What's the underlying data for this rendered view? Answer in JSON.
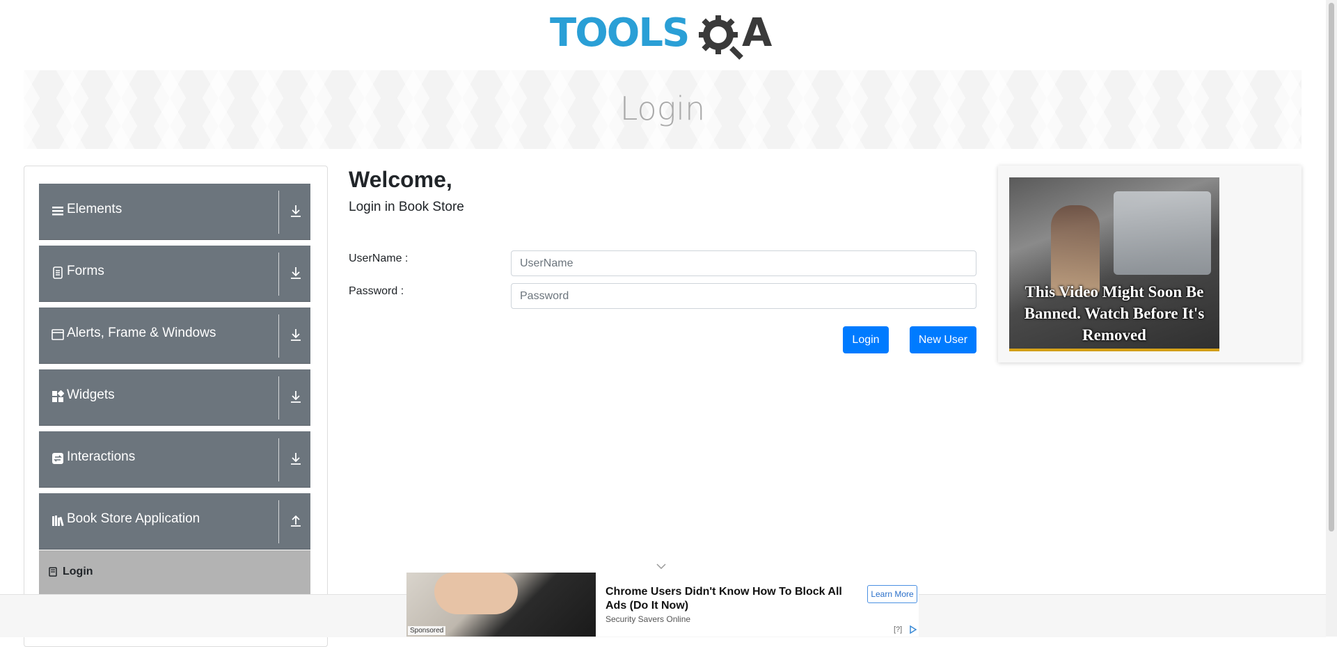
{
  "logo": {
    "text_tools": "TOOLS",
    "text_a": "A",
    "brand_color": "#2a9fd6"
  },
  "banner": {
    "title": "Login"
  },
  "sidebar": {
    "groups": [
      {
        "label": "Elements",
        "icon": "hamburger-icon",
        "state": "collapsed"
      },
      {
        "label": "Forms",
        "icon": "document-icon",
        "state": "collapsed"
      },
      {
        "label": "Alerts, Frame & Windows",
        "icon": "window-icon",
        "state": "collapsed"
      },
      {
        "label": "Widgets",
        "icon": "widgets-icon",
        "state": "collapsed"
      },
      {
        "label": "Interactions",
        "icon": "interactions-icon",
        "state": "collapsed"
      },
      {
        "label": "Book Store Application",
        "icon": "books-icon",
        "state": "expanded"
      }
    ],
    "submenu": {
      "label": "Login",
      "icon": "book-icon"
    },
    "header_color": "#6c757d",
    "active_item_color": "#b3b3b3"
  },
  "main": {
    "welcome": "Welcome,",
    "subtitle": "Login in Book Store",
    "username_label": "UserName :",
    "username_placeholder": "UserName",
    "password_label": "Password :",
    "password_placeholder": "Password",
    "login_button": "Login",
    "new_user_button": "New User",
    "button_color": "#007bff"
  },
  "right_ad": {
    "caption": "This Video Might Soon Be Banned. Watch Before It's Removed"
  },
  "bottom_ad": {
    "headline": "Chrome Users Didn't Know How To Block All Ads (Do It Now)",
    "source": "Security Savers Online",
    "learn_more": "Learn More",
    "sponsored": "Sponsored",
    "choices": "[?]"
  }
}
